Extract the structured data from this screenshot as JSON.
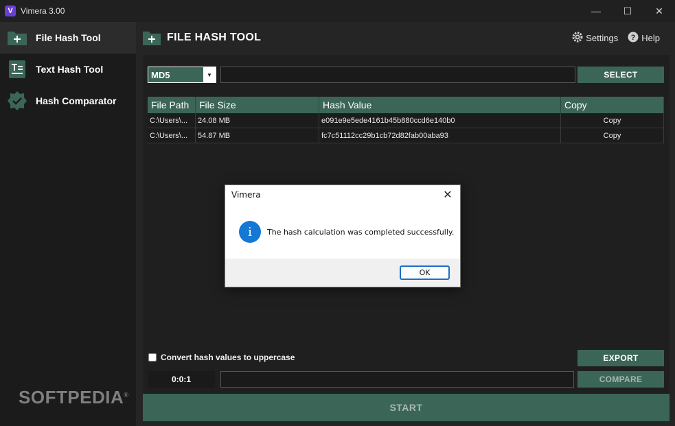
{
  "window": {
    "title": "Vimera 3.00",
    "logo_letter": "V",
    "minimize": "—",
    "maximize": "☐",
    "close": "✕"
  },
  "sidebar": {
    "items": [
      {
        "label": "File Hash Tool",
        "icon": "file-plus-icon",
        "active": true
      },
      {
        "label": "Text Hash Tool",
        "icon": "text-document-icon",
        "active": false
      },
      {
        "label": "Hash Comparator",
        "icon": "check-badge-icon",
        "active": false
      }
    ],
    "watermark": "SOFTPEDIA",
    "watermark_mark": "®"
  },
  "header": {
    "title": "FILE HASH TOOL",
    "settings_label": "Settings",
    "help_label": "Help"
  },
  "toolbar": {
    "algorithm": "MD5",
    "path_value": "",
    "select_label": "SELECT"
  },
  "table": {
    "columns": [
      "File Path",
      "File Size",
      "Hash Value",
      "Copy"
    ],
    "rows": [
      {
        "path": "C:\\Users\\...",
        "size": "24.08 MB",
        "hash": "e091e9e5ede4161b45b880ccd6e140b0",
        "copy": "Copy"
      },
      {
        "path": "C:\\Users\\...",
        "size": "54.87 MB",
        "hash": "fc7c51112cc29b1cb72d82fab00aba93",
        "copy": "Copy"
      }
    ]
  },
  "options": {
    "uppercase_label": "Convert hash values to uppercase",
    "uppercase_checked": false
  },
  "footer": {
    "timer": "0:0:1",
    "export_label": "EXPORT",
    "compare_label": "COMPARE",
    "start_label": "START"
  },
  "dialog": {
    "title": "Vimera",
    "message": "The hash calculation was completed successfully.",
    "ok_label": "OK",
    "close": "✕",
    "info_glyph": "i"
  },
  "colors": {
    "accent": "#3b6657",
    "background": "#1e1e1e",
    "dialog_info": "#1478d4"
  }
}
